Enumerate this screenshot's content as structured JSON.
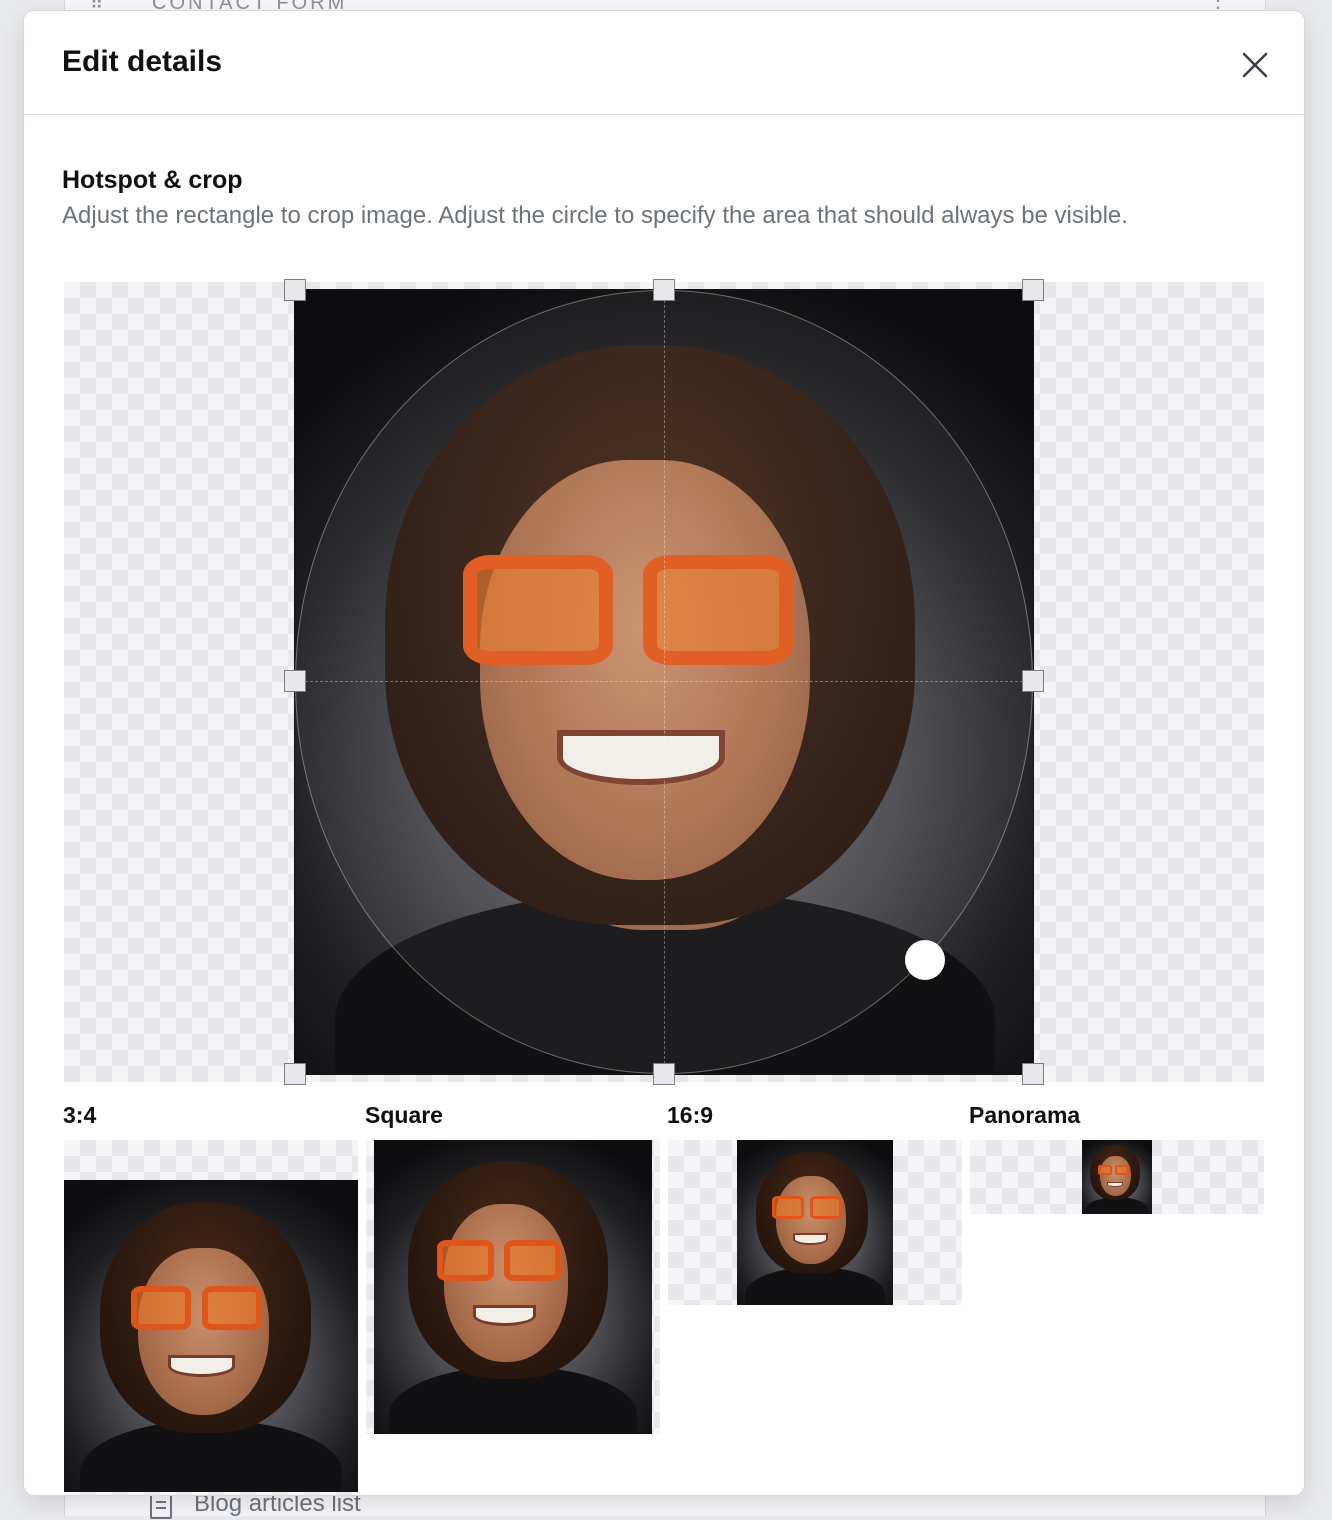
{
  "background": {
    "top_row_label": "CONTACT FORM",
    "bottom_row_label": "Blog articles list",
    "icons": [
      "drag-handle-icon",
      "kebab-menu-icon",
      "document-icon"
    ]
  },
  "dialog": {
    "title": "Edit details",
    "close_icon": "close-icon"
  },
  "hotspot_crop": {
    "title": "Hotspot & crop",
    "description": "Adjust the rectangle to crop image. Adjust the circle to specify the area that should always be visible."
  },
  "previews": [
    {
      "label": "3:4"
    },
    {
      "label": "Square"
    },
    {
      "label": "16:9"
    },
    {
      "label": "Panorama"
    }
  ],
  "colors": {
    "glasses": "#e0561a",
    "backdrop_dark": "#0d0d0f",
    "muted_text": "#6e7280"
  }
}
